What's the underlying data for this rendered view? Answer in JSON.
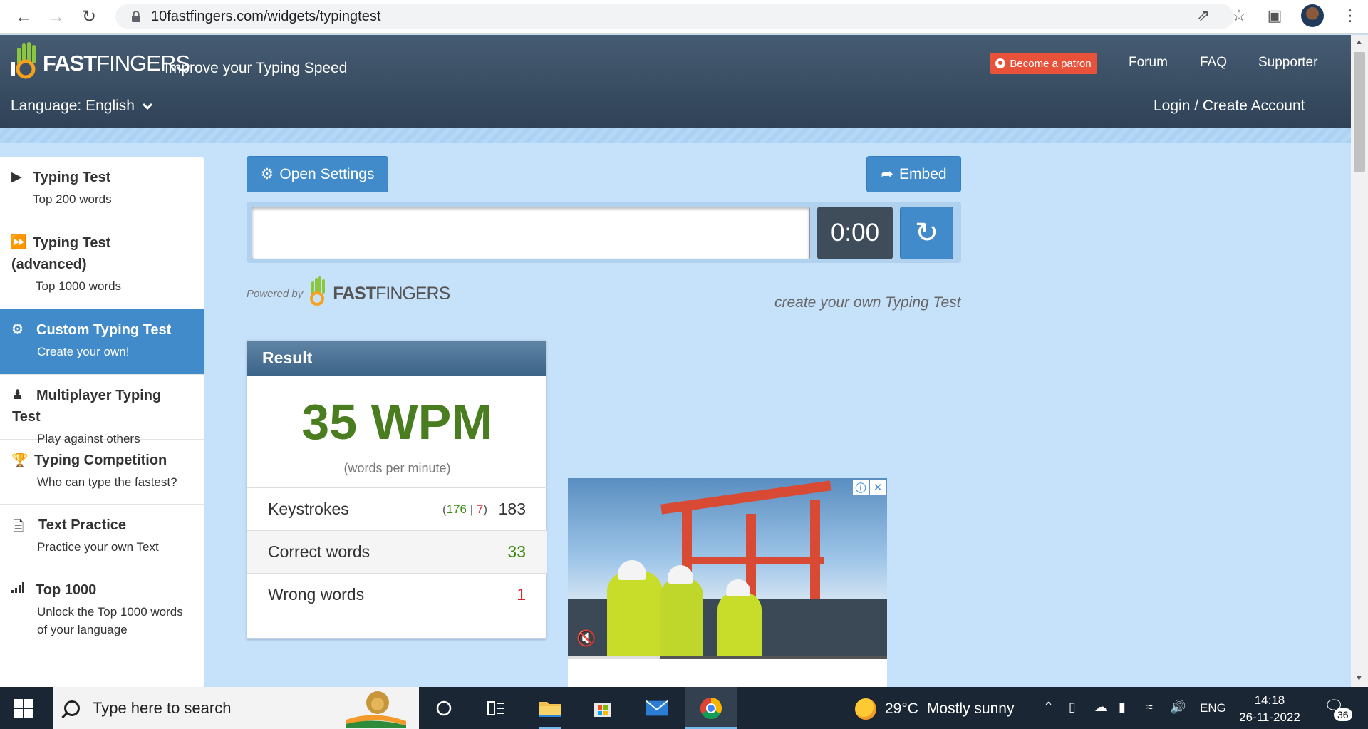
{
  "browser": {
    "url": "10fastfingers.com/widgets/typingtest"
  },
  "header": {
    "logo_prefix": "10",
    "logo_bold": "FAST",
    "logo_light": "FINGERS",
    "tagline": "Improve your Typing Speed",
    "patron_label": "Become a patron",
    "nav": [
      "Forum",
      "FAQ",
      "Supporter"
    ],
    "language_label": "Language: English",
    "login_label": "Login / Create Account"
  },
  "sidebar": {
    "items": [
      {
        "title": "Typing Test",
        "sub": "Top 200 words",
        "icon": "play-icon"
      },
      {
        "title": "Typing Test (advanced)",
        "sub": "Top 1000 words",
        "icon": "fast-forward-icon"
      },
      {
        "title": "Custom Typing Test",
        "sub": "Create your own!",
        "icon": "gears-icon",
        "active": true
      },
      {
        "title": "Multiplayer Typing Test",
        "sub": "Play against others",
        "icon": "users-icon"
      },
      {
        "title": "Typing Competition",
        "sub": "Who can type the fastest?",
        "icon": "trophy-icon"
      },
      {
        "title": "Text Practice",
        "sub": "Practice your own Text",
        "icon": "document-icon"
      },
      {
        "title": "Top 1000",
        "sub": "Unlock the Top 1000 words of your language",
        "icon": "signal-icon"
      }
    ]
  },
  "widget": {
    "open_settings_label": "Open Settings",
    "embed_label": "Embed",
    "input_value": "",
    "timer": "0:00",
    "powered_by": "Powered by",
    "create_link": "create your own Typing Test"
  },
  "result": {
    "title": "Result",
    "wpm": "35 WPM",
    "wpm_sub": "(words per minute)",
    "keystrokes_label": "Keystrokes",
    "keystrokes_correct": "176",
    "keystrokes_wrong": "7",
    "keystrokes_total": "183",
    "correct_label": "Correct words",
    "correct_value": "33",
    "wrong_label": "Wrong words",
    "wrong_value": "1"
  },
  "taskbar": {
    "search_placeholder": "Type here to search",
    "weather_temp": "29°C",
    "weather_text": "Mostly sunny",
    "language": "ENG",
    "time": "14:18",
    "date": "26-11-2022",
    "notifications": "36"
  },
  "colors": {
    "accent": "#428bca",
    "header": "#2f4257",
    "page_bg": "#c6e2fb",
    "wpm_green": "#4a7d1f",
    "wrong_red": "#d9232d",
    "patron": "#e8513a"
  }
}
